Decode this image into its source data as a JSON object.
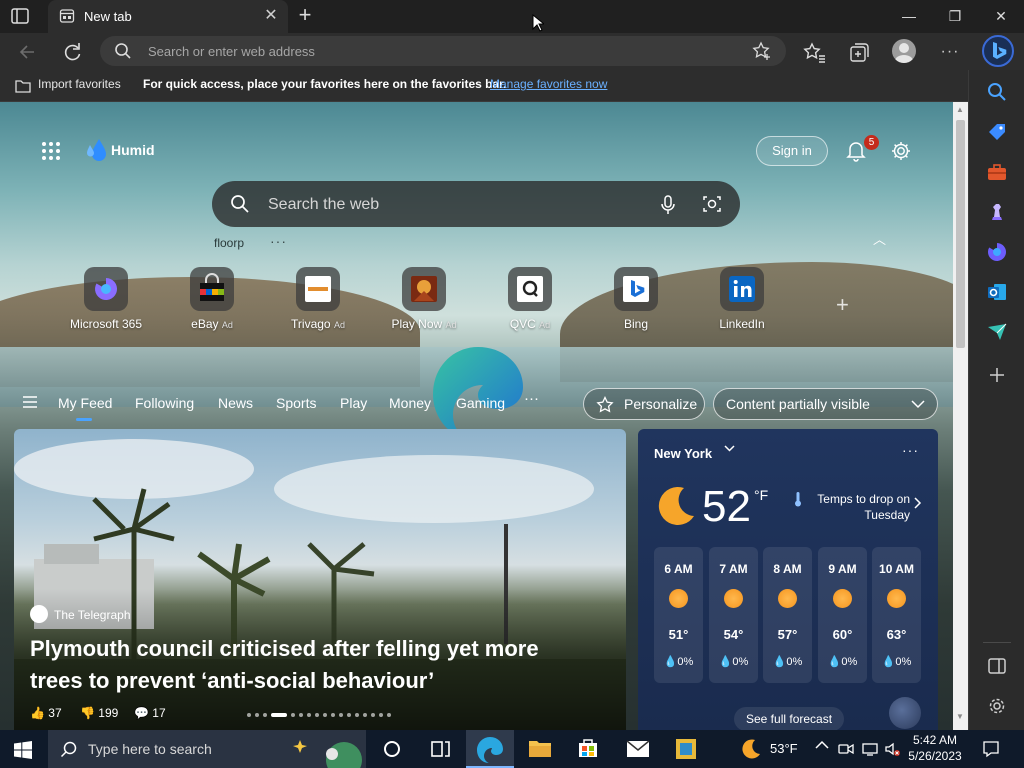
{
  "browser": {
    "tab_title": "New tab",
    "new_tab_symbol": "+",
    "close_tab_symbol": "✕",
    "window_controls": {
      "minimize": "—",
      "restore": "❐",
      "close": "✕"
    },
    "address_placeholder": "Search or enter web address",
    "favorites_bar": {
      "import_label": "Import favorites",
      "message": "For quick access, place your favorites here on the favorites bar.",
      "link_label": "Manage favorites now"
    },
    "more_symbol": "···"
  },
  "ntp": {
    "brand": "Humid",
    "sign_in": "Sign in",
    "notification_count": "5",
    "search_placeholder": "Search the web",
    "suggestion": "floorp",
    "suggestion_more": "···",
    "collapse_symbol": "︿",
    "add_site_symbol": "+",
    "quick_links": [
      {
        "label": "Microsoft 365",
        "ad": ""
      },
      {
        "label": "eBay",
        "ad": "Ad"
      },
      {
        "label": "Trivago",
        "ad": "Ad"
      },
      {
        "label": "Play Now",
        "ad": "Ad"
      },
      {
        "label": "QVC",
        "ad": "Ad"
      },
      {
        "label": "Bing",
        "ad": ""
      },
      {
        "label": "LinkedIn",
        "ad": ""
      }
    ]
  },
  "feed": {
    "tabs": [
      "My Feed",
      "Following",
      "News",
      "Sports",
      "Play",
      "Money",
      "Gaming"
    ],
    "more_symbol": "···",
    "personalize": "Personalize",
    "content_visibility": "Content partially visible",
    "hero": {
      "source": "The Telegraph",
      "title": "Plymouth council criticised after felling yet more trees to prevent ‘anti-social behaviour’",
      "likes": "37",
      "dislikes": "199",
      "comments": "17"
    }
  },
  "weather": {
    "city": "New York",
    "temp": "52",
    "unit": "°F",
    "alert": "Temps to drop on Tuesday",
    "hourly": [
      {
        "time": "6 AM",
        "temp": "51°",
        "rain": "0%"
      },
      {
        "time": "7 AM",
        "temp": "54°",
        "rain": "0%"
      },
      {
        "time": "8 AM",
        "temp": "57°",
        "rain": "0%"
      },
      {
        "time": "9 AM",
        "temp": "60°",
        "rain": "0%"
      },
      {
        "time": "10 AM",
        "temp": "63°",
        "rain": "0%"
      }
    ],
    "forecast_button": "See full forecast",
    "more_symbol": "···"
  },
  "taskbar": {
    "search_placeholder": "Type here to search",
    "tray_temp": "53°F",
    "time": "5:42 AM",
    "date": "5/26/2023"
  },
  "colors": {
    "accent": "#4aa3ff",
    "badge": "#c42b1c",
    "link": "#6ab0ff",
    "weather_card": "#20355e"
  }
}
